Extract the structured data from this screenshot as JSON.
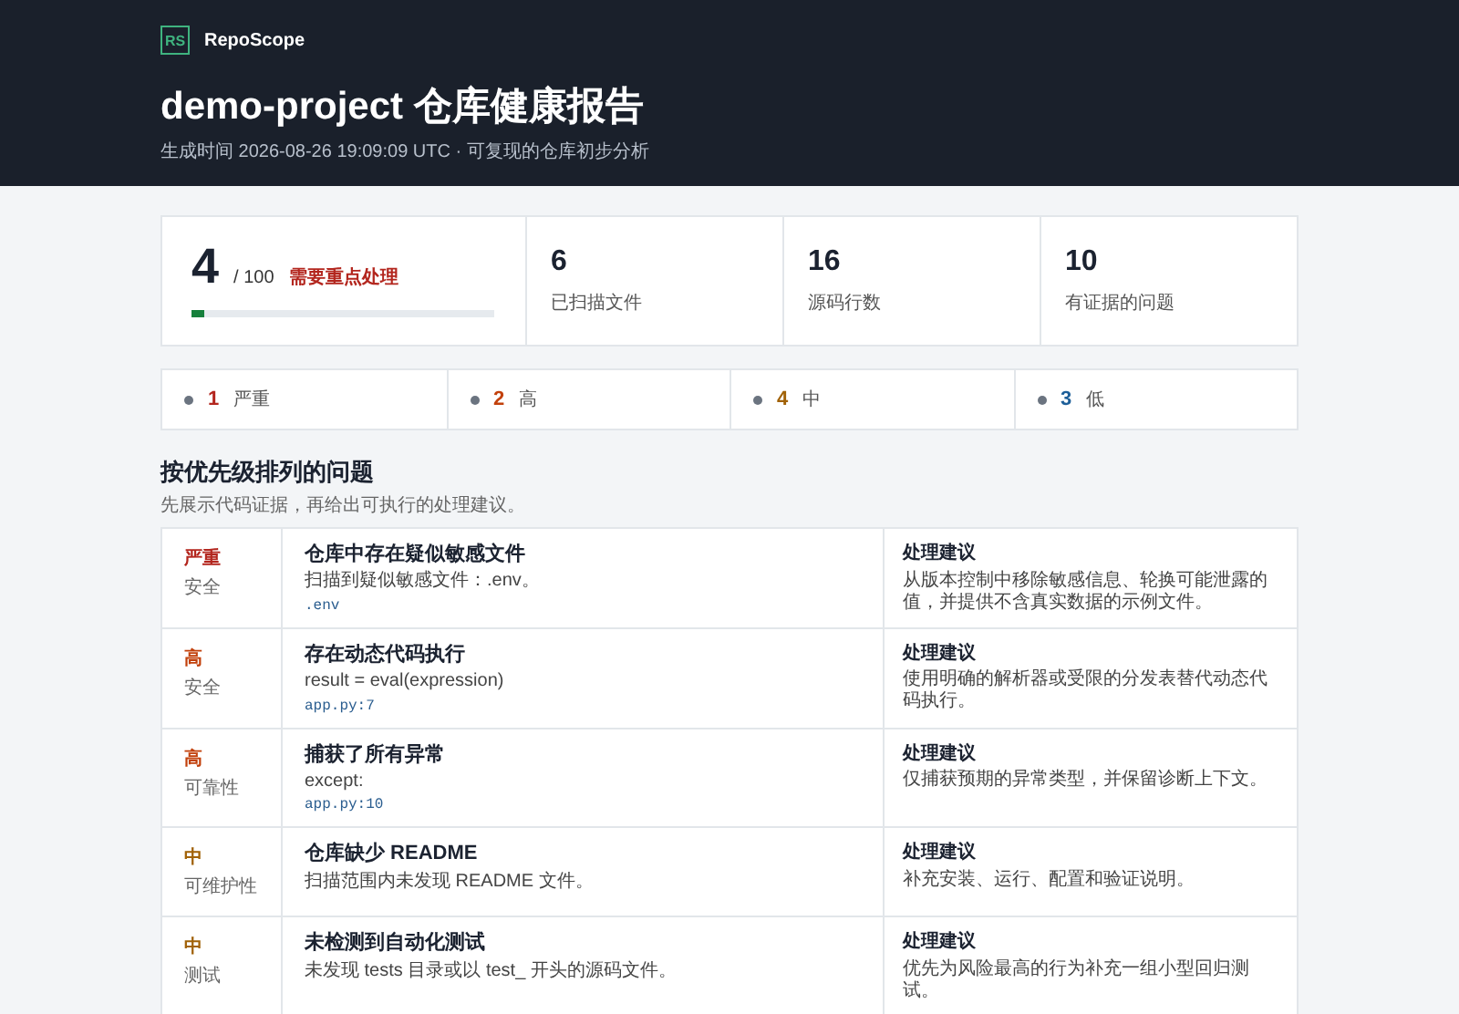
{
  "header": {
    "logo": "RS",
    "brand": "RepoScope",
    "title": "demo-project 仓库健康报告",
    "subtitle": "生成时间 2026-08-26 19:09:09 UTC · 可复现的仓库初步分析"
  },
  "score": {
    "value": "4",
    "max": "/ 100",
    "verdict": "需要重点处理",
    "level": 0.04
  },
  "stats": [
    {
      "value": "6",
      "label": "已扫描文件"
    },
    {
      "value": "16",
      "label": "源码行数"
    },
    {
      "value": "10",
      "label": "有证据的问题"
    }
  ],
  "severity_counts": [
    {
      "kind": "critical",
      "count": "1",
      "label": "严重"
    },
    {
      "kind": "high",
      "count": "2",
      "label": "高"
    },
    {
      "kind": "medium",
      "count": "4",
      "label": "中"
    },
    {
      "kind": "low",
      "count": "3",
      "label": "低"
    }
  ],
  "issues_section": {
    "title": "按优先级排列的问题",
    "subtitle": "先展示代码证据，再给出可执行的处理建议。"
  },
  "issues": [
    {
      "kind": "critical",
      "severity": "严重",
      "category": "安全",
      "title": "仓库中存在疑似敏感文件",
      "evidence": "扫描到疑似敏感文件：.env。",
      "location": ".env",
      "advice_label": "处理建议",
      "advice": "从版本控制中移除敏感信息、轮换可能泄露的值，并提供不含真实数据的示例文件。"
    },
    {
      "kind": "high",
      "severity": "高",
      "category": "安全",
      "title": "存在动态代码执行",
      "evidence": "result = eval(expression)",
      "location": "app.py:7",
      "advice_label": "处理建议",
      "advice": "使用明确的解析器或受限的分发表替代动态代码执行。"
    },
    {
      "kind": "high",
      "severity": "高",
      "category": "可靠性",
      "title": "捕获了所有异常",
      "evidence": "except:",
      "location": "app.py:10",
      "advice_label": "处理建议",
      "advice": "仅捕获预期的异常类型，并保留诊断上下文。"
    },
    {
      "kind": "medium",
      "severity": "中",
      "category": "可维护性",
      "title": "仓库缺少 README",
      "evidence": "扫描范围内未发现 README 文件。",
      "advice_label": "处理建议",
      "advice": "补充安装、运行、配置和验证说明。"
    },
    {
      "kind": "medium",
      "severity": "中",
      "category": "测试",
      "title": "未检测到自动化测试",
      "evidence": "未发现 tests 目录或以 test_ 开头的源码文件。",
      "advice_label": "处理建议",
      "advice": "优先为风险最高的行为补充一组小型回归测试。"
    }
  ]
}
